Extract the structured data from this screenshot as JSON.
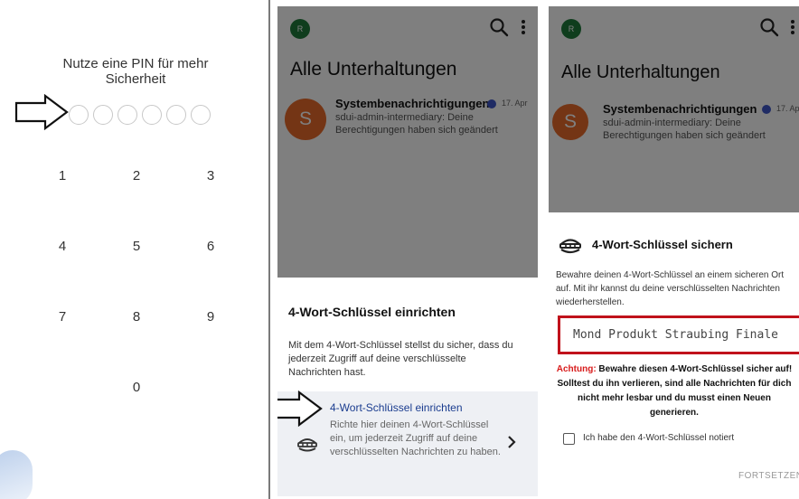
{
  "pin_screen": {
    "title": "Nutze eine PIN für mehr Sicherheit",
    "pin_length": 6,
    "keys": [
      "1",
      "2",
      "3",
      "4",
      "5",
      "6",
      "7",
      "8",
      "9",
      "0"
    ]
  },
  "chat_screen": {
    "avatar_initial": "R",
    "title": "Alle Unterhaltungen",
    "conversation": {
      "avatar_initial": "S",
      "sender": "Systembenachrichtigungen",
      "date": "17. Apr",
      "preview": "sdui-admin-intermediary: Deine Berechtigungen haben sich geändert"
    }
  },
  "setup_sheet": {
    "title": "4-Wort-Schlüssel einrichten",
    "description": "Mit dem 4-Wort-Schlüssel stellst du sicher, dass du jederzeit Zugriff auf deine verschlüsselte Nachrichten hast.",
    "option": {
      "title": "4-Wort-Schlüssel einrichten",
      "description": "Richte hier deinen 4-Wort-Schlüssel ein, um jederzeit Zugriff auf deine verschlüsselten Nachrichten zu haben.",
      "icon": "key-icon"
    }
  },
  "save_sheet": {
    "title": "4-Wort-Schlüssel sichern",
    "description": "Bewahre deinen 4-Wort-Schlüssel an einem sicheren Ort auf. Mit ihr kannst du deine verschlüsselten Nachrichten wiederherstellen.",
    "key_words": "Mond Produkt Straubing Finale",
    "warning_label": "Achtung:",
    "warning_text": " Bewahre diesen 4-Wort-Schlüssel sicher auf! Solltest du ihn verlieren, sind alle Nachrichten für dich nicht mehr lesbar und du musst einen Neuen generieren.",
    "checkbox_label": "Ich habe den 4-Wort-Schlüssel notiert",
    "continue_label": "FORTSETZEN"
  },
  "colors": {
    "accent": "#1a3c8f",
    "warning": "#d81b1b",
    "highlight_border": "#c0121b",
    "avatar_system": "#e86a2a",
    "avatar_user": "#1f7a3b"
  }
}
